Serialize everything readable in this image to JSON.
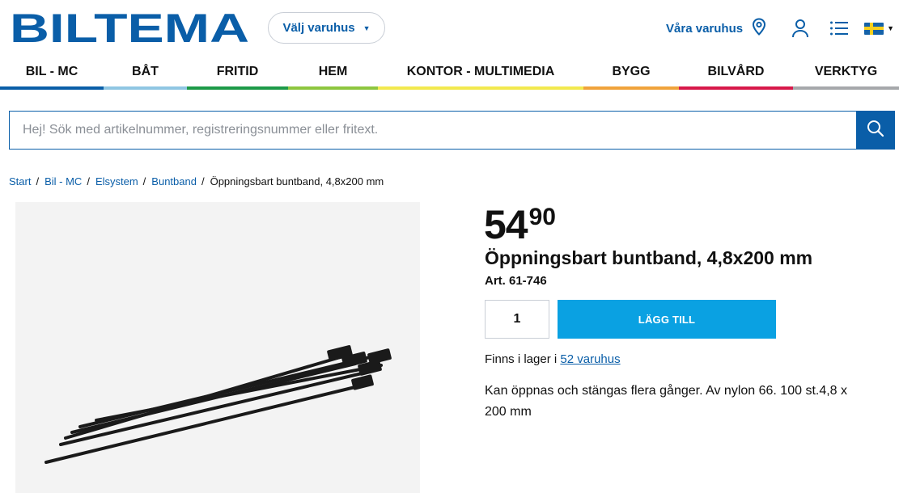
{
  "header": {
    "logo_text": "BILTEMA",
    "store_select_label": "Välj varuhus",
    "our_stores_label": "Våra varuhus",
    "icons": {
      "location": "location-pin-icon",
      "account": "user-icon",
      "list": "list-icon",
      "language": "sweden-flag-icon"
    },
    "brand_color": "#0a5ea8"
  },
  "categories": [
    {
      "label": "BIL - MC",
      "color": "#0a5ea8"
    },
    {
      "label": "BÅT",
      "color": "#8fc6e3"
    },
    {
      "label": "FRITID",
      "color": "#1d9a48"
    },
    {
      "label": "HEM",
      "color": "#8dc63f"
    },
    {
      "label": "KONTOR - MULTIMEDIA",
      "color": "#f2e94e"
    },
    {
      "label": "BYGG",
      "color": "#f0a33b"
    },
    {
      "label": "BILVÅRD",
      "color": "#d7194a"
    },
    {
      "label": "VERKTYG",
      "color": "#a6a8ab"
    }
  ],
  "search": {
    "placeholder": "Hej! Sök med artikelnummer, registreringsnummer eller fritext."
  },
  "breadcrumb": {
    "items": [
      "Start",
      "Bil - MC",
      "Elsystem",
      "Buntband"
    ],
    "current": "Öppningsbart buntband, 4,8x200 mm"
  },
  "product": {
    "price_int": "54",
    "price_dec": "90",
    "title": "Öppningsbart buntband, 4,8x200 mm",
    "article_number": "Art. 61-746",
    "quantity": "1",
    "add_to_cart_label": "LÄGG TILL",
    "stock_prefix": "Finns i lager i ",
    "stock_link": "52 varuhus",
    "description": "Kan öppnas och stängas flera gånger. Av nylon 66. 100 st.4,8 x 200 mm",
    "add_button_color": "#0aa1e2"
  }
}
